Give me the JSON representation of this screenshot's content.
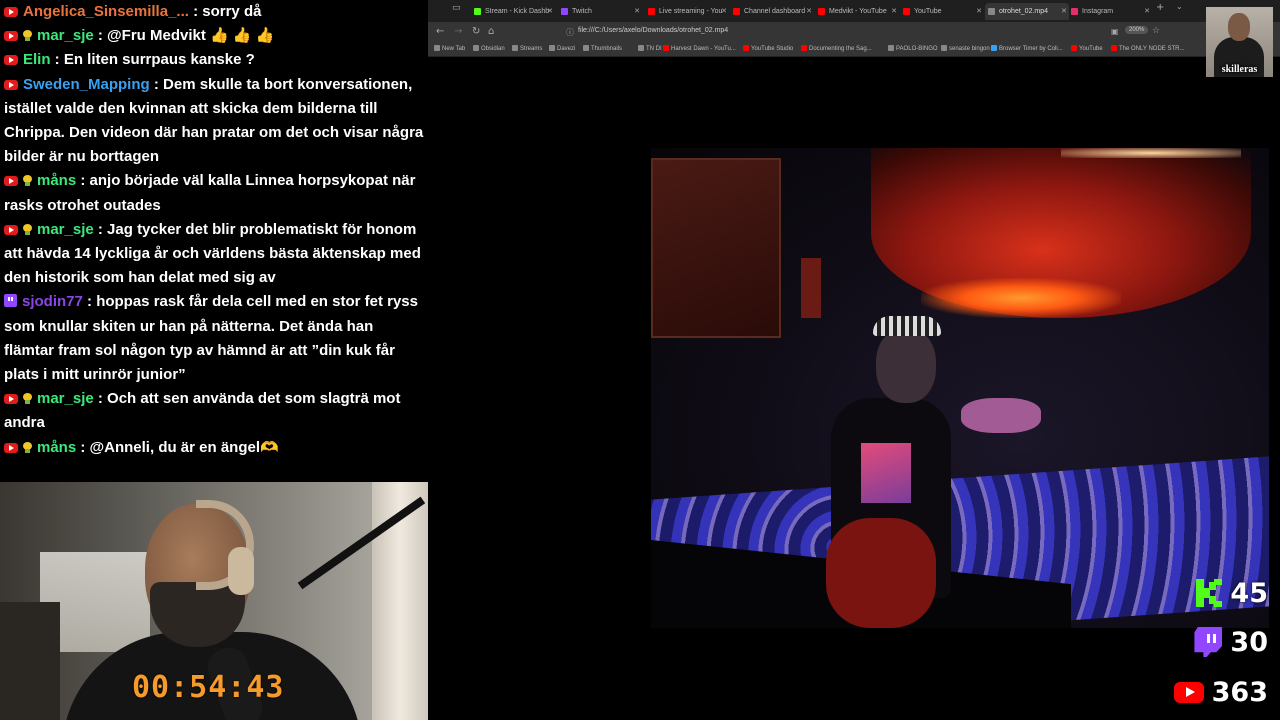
{
  "chat": {
    "messages": [
      {
        "platform": "youtube",
        "bulb": false,
        "user": "Angelica_Sinsemilla_...",
        "user_color": "#e8743b",
        "text": " : sorry då"
      },
      {
        "platform": "youtube",
        "bulb": true,
        "user": "mar_sje",
        "user_color": "#3ce87a",
        "text": " : @Fru Medvikt 👍 👍 👍"
      },
      {
        "platform": "youtube",
        "bulb": false,
        "user": "Elin",
        "user_color": "#3ce87a",
        "text": " : En liten surrpaus kanske ?"
      },
      {
        "platform": "youtube",
        "bulb": false,
        "user": "Sweden_Mapping",
        "user_color": "#3aa0f0",
        "text": " : Dem skulle ta bort konversationen, istället valde den kvinnan att skicka dem bilderna till Chrippa. Den videon där han pratar om det och visar några bilder är nu borttagen"
      },
      {
        "platform": "youtube",
        "bulb": true,
        "user": "måns",
        "user_color": "#3ce87a",
        "text": " : anjo började väl kalla Linnea horpsykopat när rasks otrohet outades"
      },
      {
        "platform": "youtube",
        "bulb": true,
        "user": "mar_sje",
        "user_color": "#3ce87a",
        "text": " : Jag tycker det blir problematiskt för honom att hävda 14 lyckliga år och världens bästa äktenskap med den historik som han delat med sig av"
      },
      {
        "platform": "twitch",
        "bulb": false,
        "user": "sjodin77",
        "user_color": "#8a45e6",
        "text": " : hoppas rask får dela cell med en stor fet ryss som knullar skiten ur han på nätterna. Det ända han flämtar fram sol någon typ av hämnd är att ”din kuk får plats i mitt urinrör junior”"
      },
      {
        "platform": "youtube",
        "bulb": true,
        "user": "mar_sje",
        "user_color": "#3ce87a",
        "text": " : Och att sen använda det som slagträ mot andra"
      },
      {
        "platform": "youtube",
        "bulb": true,
        "user": "måns",
        "user_color": "#3ce87a",
        "text": " : @Anneli, du är en ängel🫶"
      }
    ]
  },
  "timer": "00:54:43",
  "browser": {
    "tabs": [
      {
        "label": "Stream - Kick Dashb",
        "color": "#53fc18",
        "active": false
      },
      {
        "label": "Twitch",
        "color": "#9146ff",
        "active": false
      },
      {
        "label": "Live streaming - You",
        "color": "#ff0000",
        "active": false
      },
      {
        "label": "Channel dashboard",
        "color": "#ff0000",
        "active": false
      },
      {
        "label": "Medvikt - YouTube",
        "color": "#ff0000",
        "active": false
      },
      {
        "label": "YouTube",
        "color": "#ff0000",
        "active": false
      },
      {
        "label": "otrohet_02.mp4",
        "color": "#888888",
        "active": true
      },
      {
        "label": "Instagram",
        "color": "#e1306c",
        "active": false
      }
    ],
    "url": "file:///C:/Users/axelo/Downloads/otrohet_02.mp4",
    "zoom": "200%",
    "bookmarks": [
      {
        "label": "New Tab",
        "color": "#888888"
      },
      {
        "label": "Obsidian",
        "color": "#888888"
      },
      {
        "label": "Streams",
        "color": "#888888"
      },
      {
        "label": "Davezi",
        "color": "#888888"
      },
      {
        "label": "Thumbnails",
        "color": "#888888"
      },
      {
        "label": "TN DI",
        "color": "#888888"
      },
      {
        "label": "Harvest Dawn - YouTu...",
        "color": "#ff0000"
      },
      {
        "label": "YouTube Studio",
        "color": "#ff0000"
      },
      {
        "label": "Documenting the Sag...",
        "color": "#ff0000"
      },
      {
        "label": "PAOLO-BINGO",
        "color": "#888888"
      },
      {
        "label": "senaste bingon",
        "color": "#888888"
      },
      {
        "label": "Browser Timer by Coli...",
        "color": "#3aa0f0"
      },
      {
        "label": "YouTube",
        "color": "#ff0000"
      },
      {
        "label": "The ONLY NODE STR...",
        "color": "#ff0000"
      }
    ]
  },
  "guest": {
    "name": "skilleras"
  },
  "viewers": {
    "kick": "45",
    "twitch": "30",
    "youtube": "363"
  },
  "colors": {
    "kick": "#53fc18",
    "twitch": "#9146ff",
    "youtube": "#ff0000",
    "timer": "#f59a2b"
  }
}
